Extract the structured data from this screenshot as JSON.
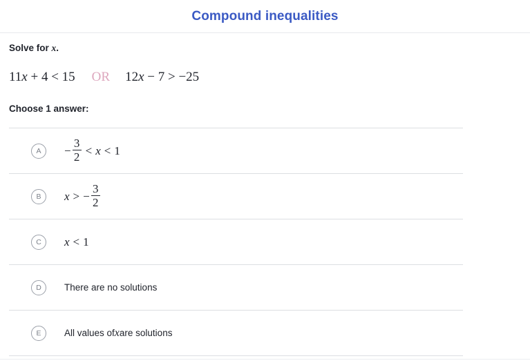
{
  "header": {
    "title": "Compound inequalities",
    "title_color": "#3b5ac4"
  },
  "problem": {
    "instruction_prefix": "Solve for ",
    "instruction_var": "x",
    "instruction_suffix": ".",
    "equation": {
      "left": "11x + 4 < 15",
      "left_parts": {
        "coef": "11",
        "var": "x",
        "rest": " + 4 < 15"
      },
      "connector": "OR",
      "connector_color": "#dda6bd",
      "right_parts": {
        "coef": "12",
        "var": "x",
        "rest": " − 7 > −25"
      },
      "right": "12x − 7 > −25"
    },
    "choose_label": "Choose 1 answer:"
  },
  "options": [
    {
      "letter": "A",
      "kind": "math-fraction-compound",
      "text": "−3/2 < x < 1",
      "sign": "−",
      "numerator": "3",
      "denominator": "2",
      "op1": "<",
      "var": "x",
      "op2": "<",
      "bound": "1"
    },
    {
      "letter": "B",
      "kind": "math-fraction-simple",
      "text": "x > −3/2",
      "var": "x",
      "op1": ">",
      "sign": "−",
      "numerator": "3",
      "denominator": "2"
    },
    {
      "letter": "C",
      "kind": "math-simple",
      "text": "x < 1",
      "var": "x",
      "op1": "<",
      "bound": "1"
    },
    {
      "letter": "D",
      "kind": "plain",
      "text": "There are no solutions"
    },
    {
      "letter": "E",
      "kind": "plain-with-var",
      "text_before": "All values of ",
      "var": "x",
      "text_after": " are solutions",
      "text": "All values of x are solutions"
    }
  ]
}
